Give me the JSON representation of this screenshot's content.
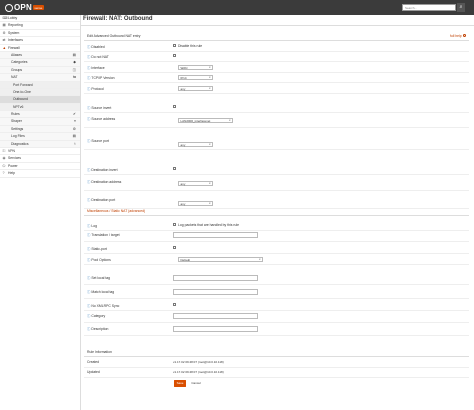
{
  "topbar": {
    "logo_text": "OPN",
    "logo_badge": "sense",
    "search_placeholder": "Search...",
    "search_icon": "search-icon"
  },
  "sidebar": {
    "items": [
      {
        "icon": "⌨",
        "label": "Lobby"
      },
      {
        "icon": "▦",
        "label": "Reporting"
      },
      {
        "icon": "⚙",
        "label": "System"
      },
      {
        "icon": "⇄",
        "label": "Interfaces"
      },
      {
        "icon": "🔥",
        "label": "Firewall"
      }
    ],
    "firewall_sub": [
      {
        "label": "Aliases",
        "ricon": "▤"
      },
      {
        "label": "Categories",
        "ricon": "◆"
      },
      {
        "label": "Groups",
        "ricon": "◫"
      },
      {
        "label": "NAT",
        "ricon": "⇆"
      }
    ],
    "nat_sub": [
      {
        "label": "Port Forward"
      },
      {
        "label": "One-to-One"
      },
      {
        "label": "Outbound"
      },
      {
        "label": "NPTv6"
      }
    ],
    "firewall_sub2": [
      {
        "label": "Rules",
        "ricon": "✔"
      },
      {
        "label": "Shaper",
        "ricon": "≡"
      },
      {
        "label": "Settings",
        "ricon": "⚙"
      },
      {
        "label": "Log Files",
        "ricon": "▤"
      },
      {
        "label": "Diagnostics",
        "ricon": "⚕"
      }
    ],
    "bottom": [
      {
        "icon": "⚿",
        "label": "VPN"
      },
      {
        "icon": "◉",
        "label": "Services"
      },
      {
        "icon": "⏻",
        "label": "Power"
      },
      {
        "icon": "?",
        "label": "Help"
      }
    ]
  },
  "page": {
    "title": "Firewall: NAT: Outbound",
    "section1": "Edit Advanced Outbound NAT entry",
    "advanced_link": "full help",
    "section2": "Miscellaneous / Static NAT (advanced)",
    "rules_info": "Rule Information"
  },
  "fields": {
    "disabled": {
      "label": "Disabled",
      "cb_label": "Disable this rule"
    },
    "do_not_nat": {
      "label": "Do not NAT"
    },
    "interface": {
      "label": "Interface",
      "value": "WAN"
    },
    "tcpip": {
      "label": "TCP/IP Version",
      "value": "IPv4"
    },
    "protocol": {
      "label": "Protocol",
      "value": "any"
    },
    "src_invert": {
      "label": "Source invert"
    },
    "src_address": {
      "label": "Source address",
      "value": "LAN2000_interfacenet"
    },
    "src_port": {
      "label": "Source port",
      "value": "any"
    },
    "dst_invert": {
      "label": "Destination invert"
    },
    "dst_address": {
      "label": "Destination address",
      "value": "any"
    },
    "dst_port": {
      "label": "Destination port",
      "value": "any"
    },
    "log": {
      "label": "Log",
      "cb_label": "Log packets that are handled by this rule"
    },
    "translation": {
      "label": "Translation / target"
    },
    "static_port": {
      "label": "Static-port"
    },
    "pool_options": {
      "label": "Pool Options",
      "value": "Default"
    },
    "set_local_tag": {
      "label": "Set local tag"
    },
    "match_local_tag": {
      "label": "Match local tag"
    },
    "no_xmlrpc": {
      "label": "No XMLRPC Sync"
    },
    "category": {
      "label": "Category"
    },
    "description": {
      "label": "Description"
    },
    "created": {
      "label": "Created",
      "value": "v1.17.02 09:48:07 (root@10.0.10.118)"
    },
    "updated": {
      "label": "Updated",
      "value": "v1.17.02 09:48:07 (root@10.0.10.118)"
    }
  },
  "buttons": {
    "save": "Save",
    "cancel": "Cancel"
  },
  "colors": {
    "accent": "#d94f00",
    "topbar": "#3b3b3b",
    "info_icon": "#1a6db3"
  }
}
